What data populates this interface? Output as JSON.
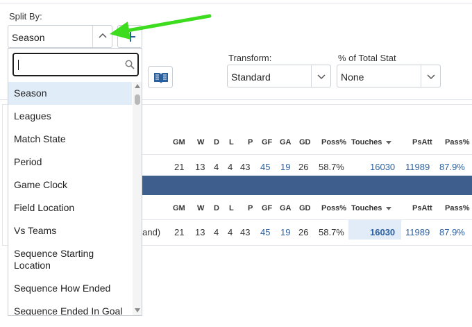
{
  "split_by": {
    "label": "Split By:",
    "selected": "Season",
    "add_icon": "plus-icon",
    "chevron_icon": "chevron-up-icon"
  },
  "dropdown": {
    "search_placeholder": "",
    "search_icon": "search-icon",
    "options": [
      "Season",
      "Leagues",
      "Match State",
      "Period",
      "Game Clock",
      "Field Location",
      "Vs Teams",
      "Sequence Starting Location",
      "Sequence How Ended",
      "Sequence Ended In Goal"
    ],
    "selected_index": 0
  },
  "glossary_icon": "book-icon",
  "transform": {
    "label": "Transform:",
    "value": "Standard"
  },
  "pct_total": {
    "label": "% of Total Stat",
    "value": "None"
  },
  "table": {
    "columns": [
      "GM",
      "W",
      "D",
      "L",
      "P",
      "GF",
      "GA",
      "GD",
      "Poss%",
      "Touches",
      "PsAtt",
      "Pass%"
    ],
    "sorted_column": "Touches",
    "row1": [
      "21",
      "13",
      "4",
      "4",
      "43",
      "45",
      "19",
      "26",
      "58.7%",
      "16030",
      "11989",
      "87.9%"
    ],
    "row2_label_fragment": "gland)",
    "row2": [
      "21",
      "13",
      "4",
      "4",
      "43",
      "45",
      "19",
      "26",
      "58.7%",
      "16030",
      "11989",
      "87.9%"
    ]
  },
  "colors": {
    "accent": "#2a5f9e",
    "band": "#3e5f8e",
    "highlight": "#e1ecf8",
    "arrow": "#3ddc1f"
  }
}
